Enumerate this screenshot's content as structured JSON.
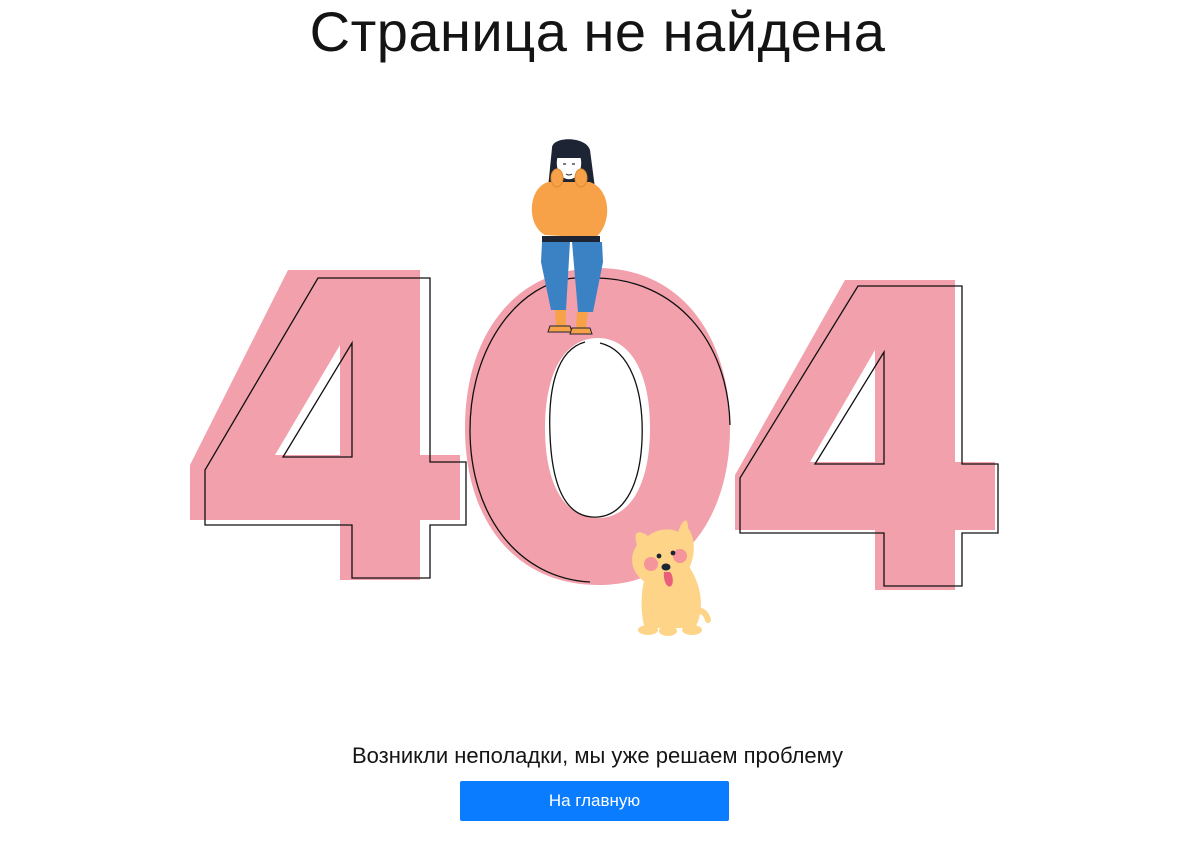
{
  "page": {
    "title": "Страница не найдена",
    "message": "Возникли неполадки, мы уже решаем проблему",
    "home_button_label": "На главную"
  },
  "illustration": {
    "number_color": "#f2a0ab",
    "outline_color": "#111111",
    "girl_sweater_color": "#f7a248",
    "girl_jeans_color": "#3b82c4",
    "girl_hair_color": "#1d2433",
    "dog_color": "#fdd488",
    "dog_cheek_color": "#f3889d",
    "icons": [
      "girl-figure-icon",
      "dog-figure-icon"
    ]
  },
  "colors": {
    "accent": "#0a7cff",
    "background": "#ffffff"
  }
}
